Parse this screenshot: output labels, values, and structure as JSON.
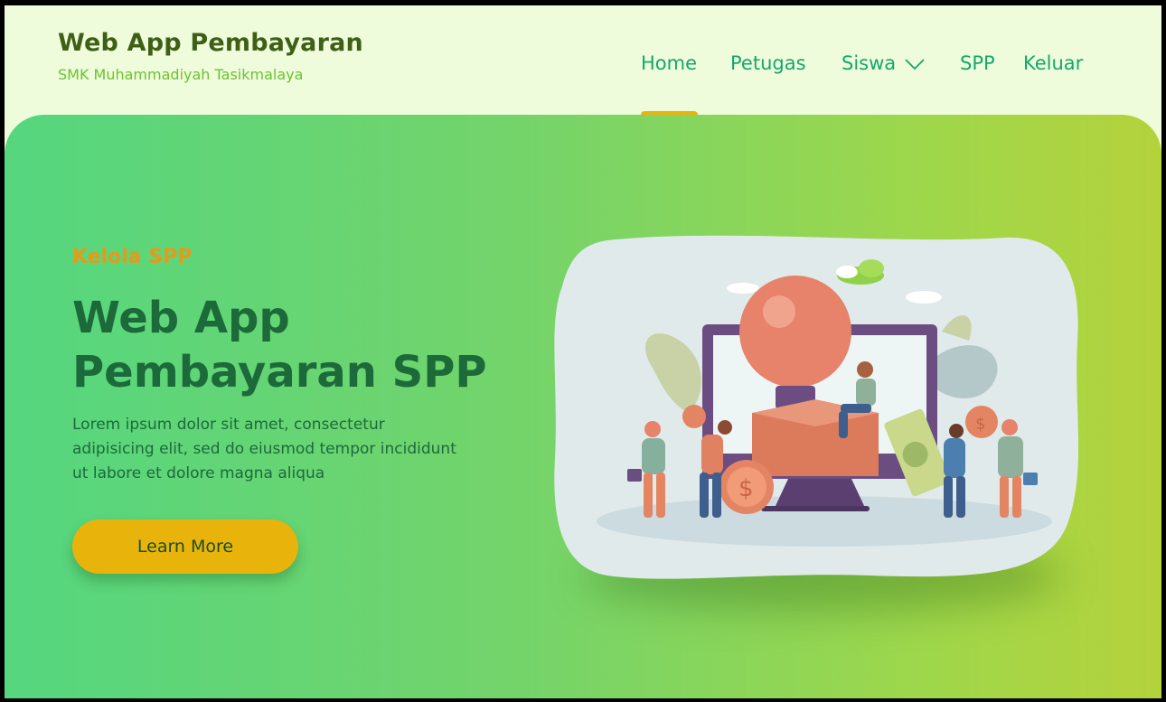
{
  "brand": {
    "title": "Web App Pembayaran",
    "subtitle": "SMK Muhammadiyah Tasikmalaya"
  },
  "nav": {
    "items": [
      {
        "label": "Home",
        "active": true
      },
      {
        "label": "Petugas"
      },
      {
        "label": "Siswa",
        "has_dropdown": true
      },
      {
        "label": "SPP"
      },
      {
        "label": "Keluar"
      }
    ]
  },
  "hero": {
    "eyebrow": "Kelola SPP",
    "headline": "Web App Pembayaran SPP",
    "paragraph": "Lorem ipsum dolor sit amet, consectetur adipisicing elit, sed do eiusmod tempor incididunt ut labore et dolore magna aliqua",
    "cta_label": "Learn More"
  },
  "colors": {
    "accent": "#e8b40c",
    "nav_text": "#14a76a",
    "headline": "#1c6a3a",
    "eyebrow": "#e59a1a",
    "header_bg": "#effcdb"
  }
}
